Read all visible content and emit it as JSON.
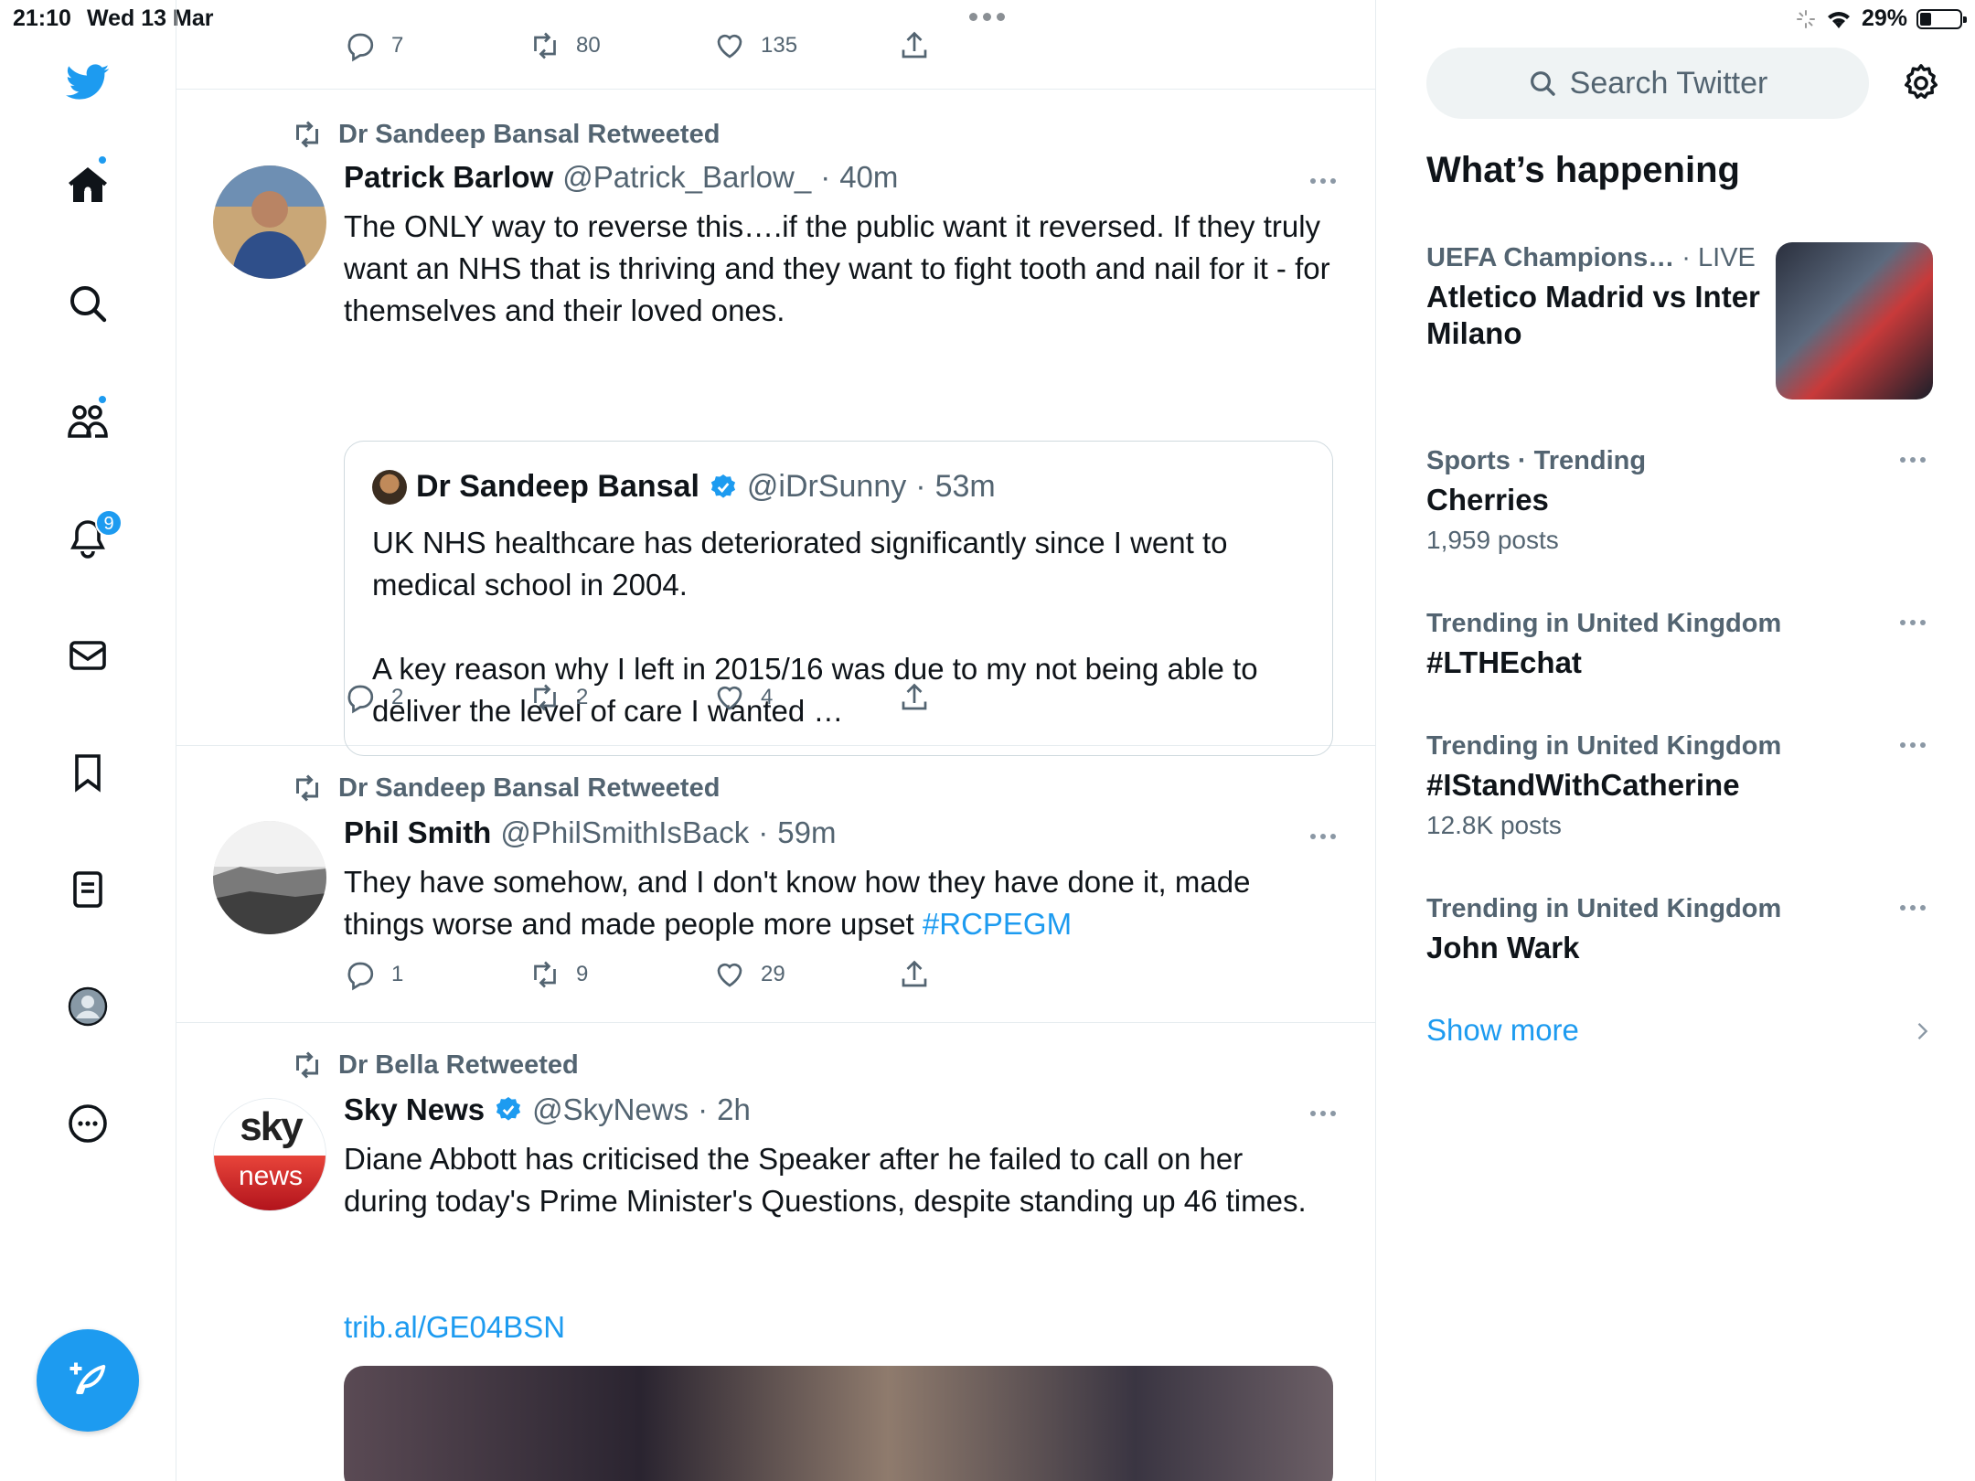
{
  "status": {
    "time": "21:10",
    "date": "Wed 13 Mar",
    "battery": "29%",
    "battery_level": 0.29
  },
  "nav": {
    "notifications_badge": "9"
  },
  "top_actions": {
    "reply": "7",
    "retweet": "80",
    "like": "135"
  },
  "tweets": [
    {
      "retweeted_by": "Dr Sandeep Bansal Retweeted",
      "name": "Patrick Barlow",
      "handle": "@Patrick_Barlow_",
      "sep": "·",
      "time": "40m",
      "text": "The ONLY way to reverse this….if the public want it reversed. If they truly want an NHS that is thriving and they want to fight tooth and nail for it - for themselves and their loved ones.",
      "quote": {
        "name": "Dr Sandeep Bansal",
        "handle": "@iDrSunny",
        "sep": "·",
        "time": "53m",
        "text1": "UK NHS healthcare has deteriorated significantly since I went to medical school in 2004.",
        "text2": "A key reason why I left in 2015/16 was due to my not being able to deliver the level of care I wanted …"
      },
      "reply": "2",
      "retweet": "2",
      "like": "4"
    },
    {
      "retweeted_by": "Dr Sandeep Bansal Retweeted",
      "name": "Phil Smith",
      "handle": "@PhilSmithIsBack",
      "sep": "·",
      "time": "59m",
      "text": "They have somehow, and I don't know how they have done it, made things worse and made people more upset ",
      "hashtag": "#RCPEGM",
      "reply": "1",
      "retweet": "9",
      "like": "29"
    },
    {
      "retweeted_by": "Dr Bella Retweeted",
      "name": "Sky News",
      "handle": "@SkyNews",
      "sep": "·",
      "time": "2h",
      "text": "Diane Abbott has criticised the Speaker after he failed to call on her during today's Prime Minister's Questions, despite standing up 46 times.",
      "link": "trib.al/GE04BSN",
      "logo_top": "sky",
      "logo_bottom": "news"
    }
  ],
  "sidebar": {
    "search_placeholder": "Search Twitter",
    "title": "What’s happening",
    "trends": [
      {
        "meta": "UEFA Champions…",
        "live": "· LIVE",
        "title": "Atletico Madrid vs Inter Milano"
      },
      {
        "meta": "Sports · Trending",
        "title": "Cherries",
        "count": "1,959 posts"
      },
      {
        "meta": "Trending in United Kingdom",
        "title": "#LTHEchat"
      },
      {
        "meta": "Trending in United Kingdom",
        "title": "#IStandWithCatherine",
        "count": "12.8K posts"
      },
      {
        "meta": "Trending in United Kingdom",
        "title": "John Wark"
      }
    ],
    "show_more": "Show more"
  },
  "colors": {
    "accent": "#1d9bf0",
    "muted": "#536471",
    "text": "#0f1419",
    "border": "#e6ecf0"
  }
}
